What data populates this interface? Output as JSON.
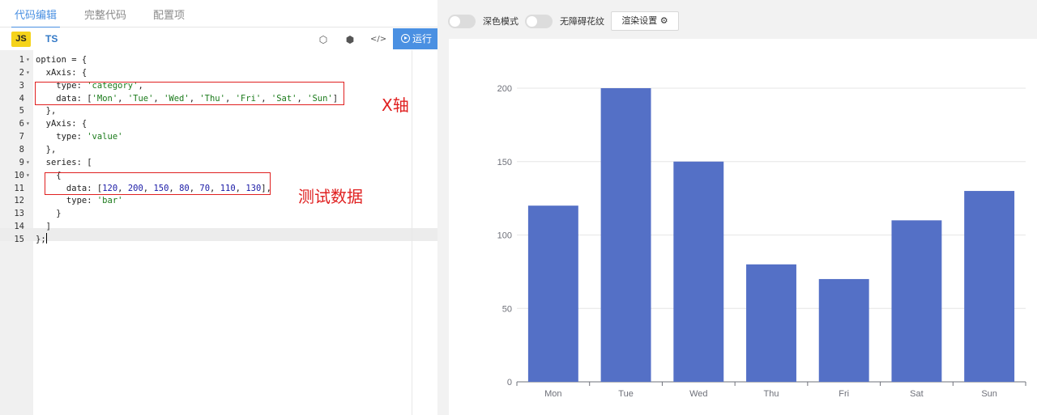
{
  "editor_tabs": [
    {
      "label": "代码编辑",
      "active": true
    },
    {
      "label": "完整代码",
      "active": false
    },
    {
      "label": "配置项",
      "active": false
    }
  ],
  "toolbar": {
    "js_label": "JS",
    "ts_label": "TS",
    "icons": [
      "codepen-icon",
      "box-icon",
      "code-icon"
    ],
    "icon_glyphs": [
      "⬡",
      "⬢",
      "</>"
    ],
    "run_label": "运行"
  },
  "code_lines": [
    {
      "n": "1",
      "fold": "▾",
      "html": "option = {"
    },
    {
      "n": "2",
      "fold": "▾",
      "html": "  xAxis: {"
    },
    {
      "n": "3",
      "fold": "",
      "html": "    type: <span class=\"str\">'category'</span>,"
    },
    {
      "n": "4",
      "fold": "",
      "html": "    data: [<span class=\"str\">'Mon'</span>, <span class=\"str\">'Tue'</span>, <span class=\"str\">'Wed'</span>, <span class=\"str\">'Thu'</span>, <span class=\"str\">'Fri'</span>, <span class=\"str\">'Sat'</span>, <span class=\"str\">'Sun'</span>]"
    },
    {
      "n": "5",
      "fold": "",
      "html": "  },"
    },
    {
      "n": "6",
      "fold": "▾",
      "html": "  yAxis: {"
    },
    {
      "n": "7",
      "fold": "",
      "html": "    type: <span class=\"str\">'value'</span>"
    },
    {
      "n": "8",
      "fold": "",
      "html": "  },"
    },
    {
      "n": "9",
      "fold": "▾",
      "html": "  series: ["
    },
    {
      "n": "10",
      "fold": "▾",
      "html": "    {"
    },
    {
      "n": "11",
      "fold": "",
      "html": "      data: [<span class=\"num\">120</span>, <span class=\"num\">200</span>, <span class=\"num\">150</span>, <span class=\"num\">80</span>, <span class=\"num\">70</span>, <span class=\"num\">110</span>, <span class=\"num\">130</span>],"
    },
    {
      "n": "12",
      "fold": "",
      "html": "      type: <span class=\"str\">'bar'</span>"
    },
    {
      "n": "13",
      "fold": "",
      "html": "    }"
    },
    {
      "n": "14",
      "fold": "",
      "html": "  ]"
    },
    {
      "n": "15",
      "fold": "",
      "html": "};"
    }
  ],
  "annotations": {
    "xaxis_note": "X轴",
    "data_note": "测试数据"
  },
  "preview_toolbar": {
    "dark_mode_label": "深色模式",
    "accessibility_label": "无障碍花纹",
    "render_settings_label": "渲染设置 ⚙"
  },
  "colors": {
    "accent": "#4a90e2",
    "bar": "#5470c6",
    "annotation": "#e02020"
  },
  "chart_data": {
    "type": "bar",
    "categories": [
      "Mon",
      "Tue",
      "Wed",
      "Thu",
      "Fri",
      "Sat",
      "Sun"
    ],
    "values": [
      120,
      200,
      150,
      80,
      70,
      110,
      130
    ],
    "ylim": [
      0,
      200
    ],
    "yticks": [
      "0",
      "50",
      "100",
      "150",
      "200"
    ],
    "grid": true,
    "title": "",
    "xlabel": "",
    "ylabel": ""
  }
}
